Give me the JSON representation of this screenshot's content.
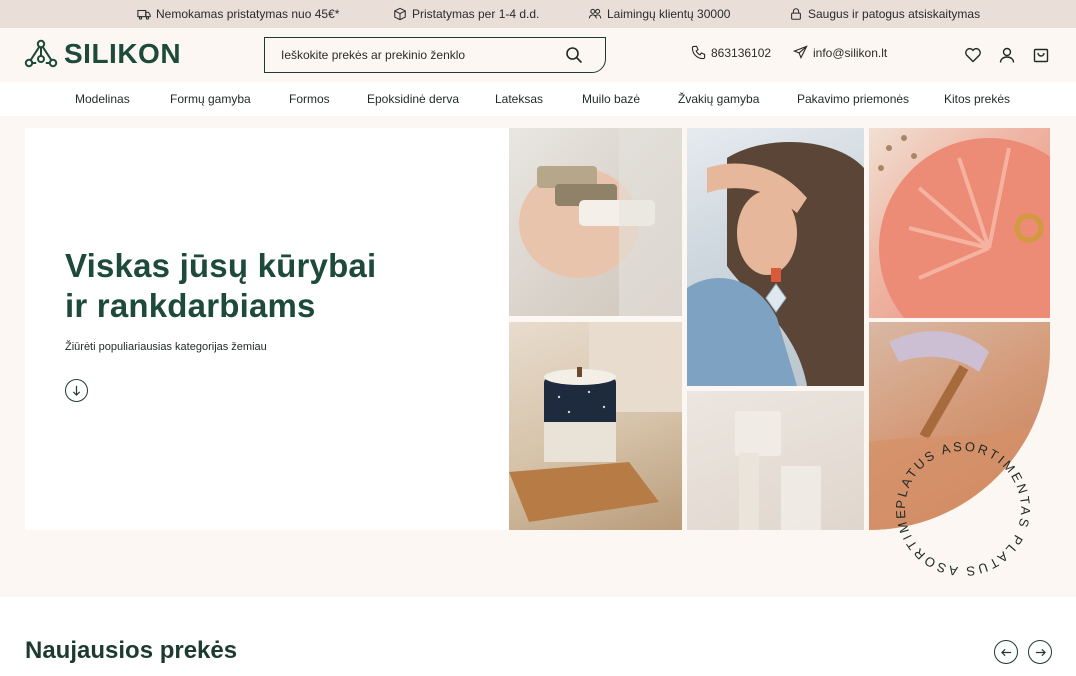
{
  "topbar": {
    "items": [
      {
        "icon": "truck-icon",
        "text": "Nemokamas pristatymas nuo 45€*"
      },
      {
        "icon": "box-icon",
        "text": "Pristatymas per 1-4 d.d."
      },
      {
        "icon": "users-icon",
        "text": "Laimingų klientų 30000"
      },
      {
        "icon": "lock-icon",
        "text": "Saugus ir patogus atsiskaitymas"
      }
    ]
  },
  "header": {
    "logo_text": "SILIKON",
    "search": {
      "placeholder": "Ieškokite prekės ar prekinio ženklo",
      "value": ""
    },
    "phone": "863136102",
    "email": "info@silikon.lt"
  },
  "nav": {
    "items": [
      {
        "label": "Modelinas"
      },
      {
        "label": "Formų gamyba"
      },
      {
        "label": "Formos"
      },
      {
        "label": "Epoksidinė derva"
      },
      {
        "label": "Lateksas"
      },
      {
        "label": "Muilo bazė"
      },
      {
        "label": "Žvakių gamyba"
      },
      {
        "label": "Pakavimo priemonės"
      },
      {
        "label": "Kitos prekės"
      }
    ]
  },
  "hero": {
    "title_line1": "Viskas jūsų kūrybai",
    "title_line2": "ir rankdarbiams",
    "subtitle": "Žiūrėti populiariausias kategorijas žemiau",
    "badge_text": "PLATUS ASORTIMENTAS PLATUS ASORTIMENTAS"
  },
  "section": {
    "title": "Naujausios prekės"
  },
  "colors": {
    "brand": "#1d4a3a",
    "topbar_bg": "#e9dfd8",
    "page_bg": "#fcf7f2"
  }
}
